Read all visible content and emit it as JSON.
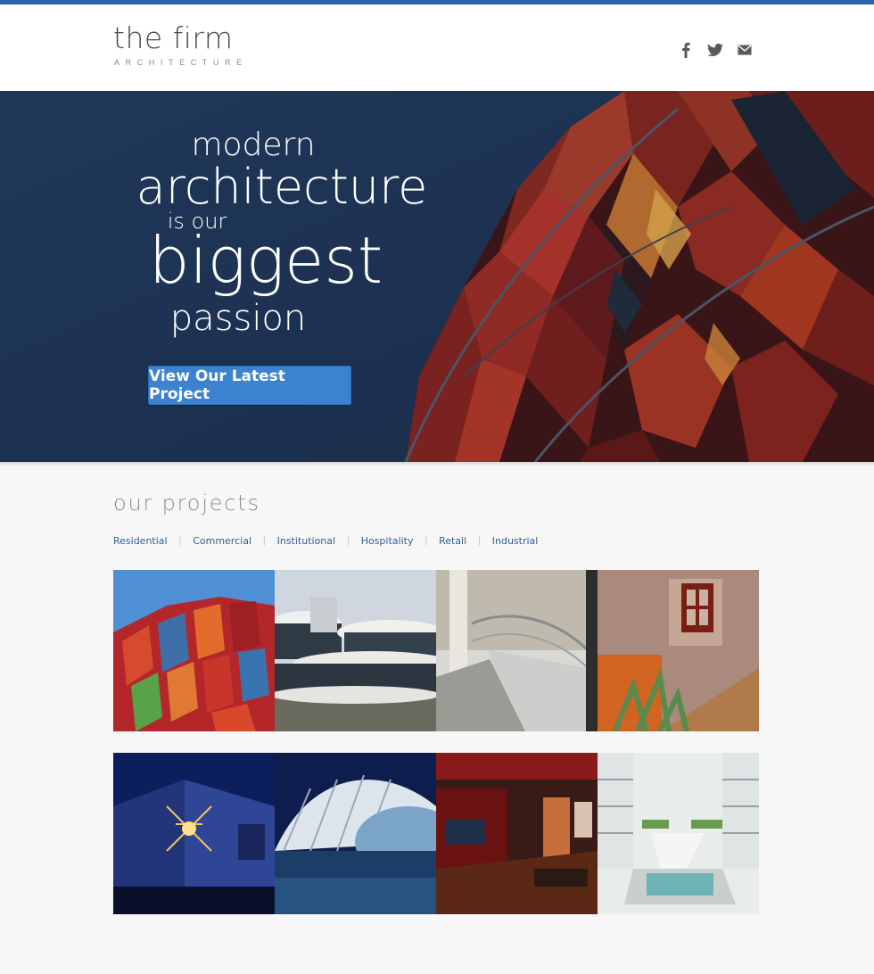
{
  "header": {
    "logo_title": "the firm",
    "logo_subtitle": "ARCHITECTURE",
    "social": [
      {
        "icon": "facebook-icon"
      },
      {
        "icon": "twitter-icon"
      },
      {
        "icon": "email-icon"
      }
    ]
  },
  "hero": {
    "line1": "modern",
    "line2": "architecture",
    "line3": "is our",
    "line4": "biggest",
    "line5": "passion",
    "button_label": "View Our Latest Project"
  },
  "projects": {
    "title": "our projects",
    "filters": [
      "Residential",
      "Commercial",
      "Institutional",
      "Hospitality",
      "Retail",
      "Industrial"
    ]
  },
  "colors": {
    "accent": "#2b64ad",
    "button": "#3b82cf",
    "hero_bg": "#233b5d",
    "link": "#2f5f96"
  }
}
